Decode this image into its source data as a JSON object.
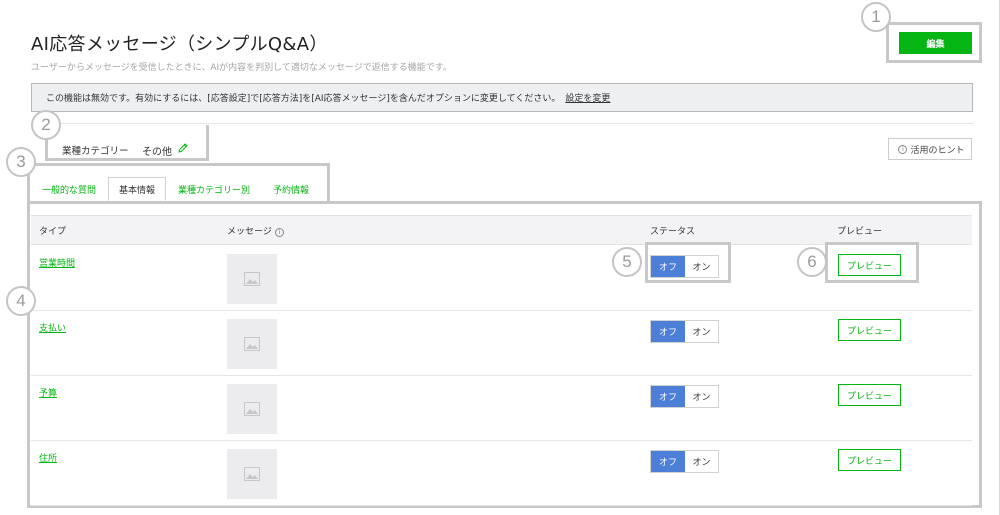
{
  "header": {
    "title": "AI応答メッセージ（シンプルQ&A）",
    "subtitle": "ユーザーからメッセージを受信したときに、AIが内容を判別して適切なメッセージで返信する機能です。",
    "edit_label": "編集"
  },
  "notice": {
    "text": "この機能は無効です。有効にするには、[応答設定]で[応答方法]を[AI応答メッセージ]を含んだオプションに変更してください。",
    "link": "設定を変更"
  },
  "category": {
    "label": "業種カテゴリー",
    "value": "その他"
  },
  "hint_label": "活用のヒント",
  "tabs": [
    {
      "label": "一般的な質問"
    },
    {
      "label": "基本情報"
    },
    {
      "label": "業種カテゴリー別"
    },
    {
      "label": "予約情報"
    }
  ],
  "table": {
    "headers": {
      "type": "タイプ",
      "message": "メッセージ",
      "status": "ステータス",
      "preview": "プレビュー"
    },
    "rows": [
      {
        "type": "営業時間",
        "off": "オフ",
        "on": "オン",
        "preview": "プレビュー"
      },
      {
        "type": "支払い",
        "off": "オフ",
        "on": "オン",
        "preview": "プレビュー"
      },
      {
        "type": "予算",
        "off": "オフ",
        "on": "オン",
        "preview": "プレビュー"
      },
      {
        "type": "住所",
        "off": "オフ",
        "on": "オン",
        "preview": "プレビュー"
      }
    ]
  },
  "callouts": [
    "1",
    "2",
    "3",
    "4",
    "5",
    "6"
  ],
  "colors": {
    "brand_green": "#05b511",
    "toggle_blue": "#4d7fd8",
    "notice_bg": "#eeeff1"
  },
  "icons": {
    "edit": "pencil-icon",
    "hint": "info-icon",
    "thumbnail": "image-placeholder-icon"
  }
}
